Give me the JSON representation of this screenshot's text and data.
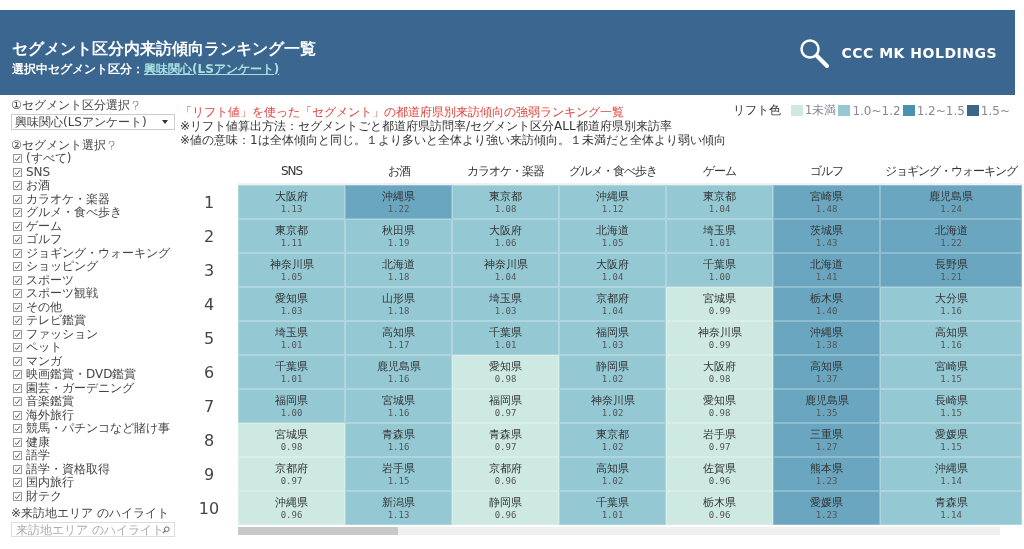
{
  "header": {
    "title": "セグメント区分内来訪傾向ランキング一覧",
    "subtitle_label": "選択中セグメント区分：",
    "subtitle_link": "興味関心(LSアンケート)",
    "logo_text": "CCC MK HOLDINGS"
  },
  "sidebar": {
    "segment_type_label": "①セグメント区分選択",
    "segment_type_value": "興味関心(LSアンケート)",
    "segment_label": "②セグメント選択",
    "items": [
      {
        "label": "(すべて)",
        "checked": true
      },
      {
        "label": "SNS",
        "checked": true
      },
      {
        "label": "お酒",
        "checked": true
      },
      {
        "label": "カラオケ・楽器",
        "checked": true
      },
      {
        "label": "グルメ・食べ歩き",
        "checked": true
      },
      {
        "label": "ゲーム",
        "checked": true
      },
      {
        "label": "ゴルフ",
        "checked": true
      },
      {
        "label": "ジョギング・ウォーキング",
        "checked": true
      },
      {
        "label": "ショッピング",
        "checked": true
      },
      {
        "label": "スポーツ",
        "checked": true
      },
      {
        "label": "スポーツ観戦",
        "checked": true
      },
      {
        "label": "その他",
        "checked": true
      },
      {
        "label": "テレビ鑑賞",
        "checked": true
      },
      {
        "label": "ファッション",
        "checked": true
      },
      {
        "label": "ペット",
        "checked": true
      },
      {
        "label": "マンガ",
        "checked": true
      },
      {
        "label": "映画鑑賞・DVD鑑賞",
        "checked": true
      },
      {
        "label": "園芸・ガーデニング",
        "checked": true
      },
      {
        "label": "音楽鑑賞",
        "checked": true
      },
      {
        "label": "海外旅行",
        "checked": true
      },
      {
        "label": "競馬・パチンコなど賭け事",
        "checked": true
      },
      {
        "label": "健康",
        "checked": true
      },
      {
        "label": "語学",
        "checked": true
      },
      {
        "label": "語学・資格取得",
        "checked": true
      },
      {
        "label": "国内旅行",
        "checked": true
      },
      {
        "label": "財テク",
        "checked": true
      }
    ],
    "highlight_label": "※来訪地エリア のハイライト",
    "highlight_placeholder": "来訪地エリア のハイライト"
  },
  "description": {
    "title": "「リフト値」を使った「セグメント」の都道府県別来訪傾向の強弱ランキング一覧",
    "note_1": "※リフト値算出方法：セグメントごと都道府県訪問率/セグメント区分ALL都道府県別来訪率",
    "note_2": "※値の意味：1は全体傾向と同じ。１より多いと全体より強い来訪傾向。１未満だと全体より弱い傾向"
  },
  "legend": {
    "title": "リフト色",
    "items": [
      {
        "label": "1未満",
        "color": "#cde9e1"
      },
      {
        "label": "1.0~1.2",
        "color": "#94c9d4"
      },
      {
        "label": "1.2~1.5",
        "color": "#4a90b0"
      },
      {
        "label": "1.5~",
        "color": "#3a6689"
      }
    ]
  },
  "table": {
    "ranks": [
      "1",
      "2",
      "3",
      "4",
      "5",
      "6",
      "7",
      "8",
      "9",
      "10"
    ],
    "columns": [
      {
        "header": "SNS",
        "cells": [
          {
            "pref": "大阪府",
            "value": "1.13",
            "color": "#94c9d4"
          },
          {
            "pref": "東京都",
            "value": "1.11",
            "color": "#94c9d4"
          },
          {
            "pref": "神奈川県",
            "value": "1.05",
            "color": "#94c9d4"
          },
          {
            "pref": "愛知県",
            "value": "1.03",
            "color": "#94c9d4"
          },
          {
            "pref": "埼玉県",
            "value": "1.01",
            "color": "#94c9d4"
          },
          {
            "pref": "千葉県",
            "value": "1.01",
            "color": "#94c9d4"
          },
          {
            "pref": "福岡県",
            "value": "1.00",
            "color": "#94c9d4"
          },
          {
            "pref": "宮城県",
            "value": "0.98",
            "color": "#cde9e1"
          },
          {
            "pref": "京都府",
            "value": "0.97",
            "color": "#cde9e1"
          },
          {
            "pref": "沖縄県",
            "value": "0.96",
            "color": "#cde9e1"
          }
        ]
      },
      {
        "header": "お酒",
        "cells": [
          {
            "pref": "沖縄県",
            "value": "1.22",
            "color": "#6aa6bf"
          },
          {
            "pref": "秋田県",
            "value": "1.19",
            "color": "#94c9d4"
          },
          {
            "pref": "北海道",
            "value": "1.18",
            "color": "#94c9d4"
          },
          {
            "pref": "山形県",
            "value": "1.18",
            "color": "#94c9d4"
          },
          {
            "pref": "高知県",
            "value": "1.17",
            "color": "#94c9d4"
          },
          {
            "pref": "鹿児島県",
            "value": "1.16",
            "color": "#94c9d4"
          },
          {
            "pref": "宮城県",
            "value": "1.16",
            "color": "#94c9d4"
          },
          {
            "pref": "青森県",
            "value": "1.16",
            "color": "#94c9d4"
          },
          {
            "pref": "岩手県",
            "value": "1.15",
            "color": "#94c9d4"
          },
          {
            "pref": "新潟県",
            "value": "1.13",
            "color": "#94c9d4"
          }
        ]
      },
      {
        "header": "カラオケ・楽器",
        "cells": [
          {
            "pref": "東京都",
            "value": "1.08",
            "color": "#94c9d4"
          },
          {
            "pref": "大阪府",
            "value": "1.06",
            "color": "#94c9d4"
          },
          {
            "pref": "神奈川県",
            "value": "1.04",
            "color": "#94c9d4"
          },
          {
            "pref": "埼玉県",
            "value": "1.03",
            "color": "#94c9d4"
          },
          {
            "pref": "千葉県",
            "value": "1.01",
            "color": "#94c9d4"
          },
          {
            "pref": "愛知県",
            "value": "0.98",
            "color": "#cde9e1"
          },
          {
            "pref": "福岡県",
            "value": "0.97",
            "color": "#cde9e1"
          },
          {
            "pref": "青森県",
            "value": "0.97",
            "color": "#cde9e1"
          },
          {
            "pref": "京都府",
            "value": "0.96",
            "color": "#cde9e1"
          },
          {
            "pref": "静岡県",
            "value": "0.96",
            "color": "#cde9e1"
          }
        ]
      },
      {
        "header": "グルメ・食べ歩き",
        "cells": [
          {
            "pref": "沖縄県",
            "value": "1.12",
            "color": "#94c9d4"
          },
          {
            "pref": "北海道",
            "value": "1.05",
            "color": "#94c9d4"
          },
          {
            "pref": "大阪府",
            "value": "1.04",
            "color": "#94c9d4"
          },
          {
            "pref": "京都府",
            "value": "1.04",
            "color": "#94c9d4"
          },
          {
            "pref": "福岡県",
            "value": "1.03",
            "color": "#94c9d4"
          },
          {
            "pref": "静岡県",
            "value": "1.02",
            "color": "#94c9d4"
          },
          {
            "pref": "神奈川県",
            "value": "1.02",
            "color": "#94c9d4"
          },
          {
            "pref": "東京都",
            "value": "1.02",
            "color": "#94c9d4"
          },
          {
            "pref": "高知県",
            "value": "1.02",
            "color": "#94c9d4"
          },
          {
            "pref": "千葉県",
            "value": "1.01",
            "color": "#94c9d4"
          }
        ]
      },
      {
        "header": "ゲーム",
        "cells": [
          {
            "pref": "東京都",
            "value": "1.04",
            "color": "#94c9d4"
          },
          {
            "pref": "埼玉県",
            "value": "1.01",
            "color": "#94c9d4"
          },
          {
            "pref": "千葉県",
            "value": "1.00",
            "color": "#94c9d4"
          },
          {
            "pref": "宮城県",
            "value": "0.99",
            "color": "#cde9e1"
          },
          {
            "pref": "神奈川県",
            "value": "0.99",
            "color": "#cde9e1"
          },
          {
            "pref": "大阪府",
            "value": "0.98",
            "color": "#cde9e1"
          },
          {
            "pref": "愛知県",
            "value": "0.98",
            "color": "#cde9e1"
          },
          {
            "pref": "岩手県",
            "value": "0.97",
            "color": "#cde9e1"
          },
          {
            "pref": "佐賀県",
            "value": "0.96",
            "color": "#cde9e1"
          },
          {
            "pref": "栃木県",
            "value": "0.96",
            "color": "#cde9e1"
          }
        ]
      },
      {
        "header": "ゴルフ",
        "cells": [
          {
            "pref": "宮崎県",
            "value": "1.48",
            "color": "#6aa6bf"
          },
          {
            "pref": "茨城県",
            "value": "1.43",
            "color": "#6aa6bf"
          },
          {
            "pref": "北海道",
            "value": "1.41",
            "color": "#6aa6bf"
          },
          {
            "pref": "栃木県",
            "value": "1.40",
            "color": "#6aa6bf"
          },
          {
            "pref": "沖縄県",
            "value": "1.38",
            "color": "#6aa6bf"
          },
          {
            "pref": "高知県",
            "value": "1.37",
            "color": "#6aa6bf"
          },
          {
            "pref": "鹿児島県",
            "value": "1.35",
            "color": "#6aa6bf"
          },
          {
            "pref": "三重県",
            "value": "1.27",
            "color": "#6aa6bf"
          },
          {
            "pref": "熊本県",
            "value": "1.23",
            "color": "#6aa6bf"
          },
          {
            "pref": "愛媛県",
            "value": "1.23",
            "color": "#6aa6bf"
          }
        ]
      },
      {
        "header": "ジョギング・ウォーキング",
        "cells": [
          {
            "pref": "鹿児島県",
            "value": "1.24",
            "color": "#6aa6bf"
          },
          {
            "pref": "北海道",
            "value": "1.22",
            "color": "#6aa6bf"
          },
          {
            "pref": "長野県",
            "value": "1.21",
            "color": "#6aa6bf"
          },
          {
            "pref": "大分県",
            "value": "1.16",
            "color": "#94c9d4"
          },
          {
            "pref": "高知県",
            "value": "1.16",
            "color": "#94c9d4"
          },
          {
            "pref": "宮崎県",
            "value": "1.15",
            "color": "#94c9d4"
          },
          {
            "pref": "長崎県",
            "value": "1.15",
            "color": "#94c9d4"
          },
          {
            "pref": "愛媛県",
            "value": "1.15",
            "color": "#94c9d4"
          },
          {
            "pref": "沖縄県",
            "value": "1.14",
            "color": "#94c9d4"
          },
          {
            "pref": "青森県",
            "value": "1.14",
            "color": "#94c9d4"
          }
        ]
      }
    ]
  }
}
